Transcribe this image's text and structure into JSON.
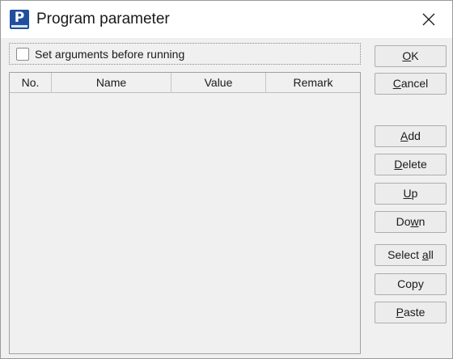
{
  "window": {
    "title": "Program parameter",
    "icon": "program-p-icon",
    "close_icon": "close-icon"
  },
  "options": {
    "set_arguments_label": "Set arguments before running",
    "set_arguments_checked": false
  },
  "table": {
    "columns": [
      "No.",
      "Name",
      "Value",
      "Remark"
    ],
    "rows": []
  },
  "buttons": {
    "ok": {
      "pre": "",
      "key": "O",
      "post": "K"
    },
    "cancel": {
      "pre": "",
      "key": "C",
      "post": "ancel"
    },
    "add": {
      "pre": "",
      "key": "A",
      "post": "dd"
    },
    "delete": {
      "pre": "",
      "key": "D",
      "post": "elete"
    },
    "up": {
      "pre": "",
      "key": "U",
      "post": "p"
    },
    "down": {
      "pre": "Do",
      "key": "w",
      "post": "n"
    },
    "select_all": {
      "pre": "Select ",
      "key": "a",
      "post": "ll"
    },
    "copy": {
      "pre": "Copy",
      "key": "",
      "post": ""
    },
    "paste": {
      "pre": "",
      "key": "P",
      "post": "aste"
    }
  }
}
